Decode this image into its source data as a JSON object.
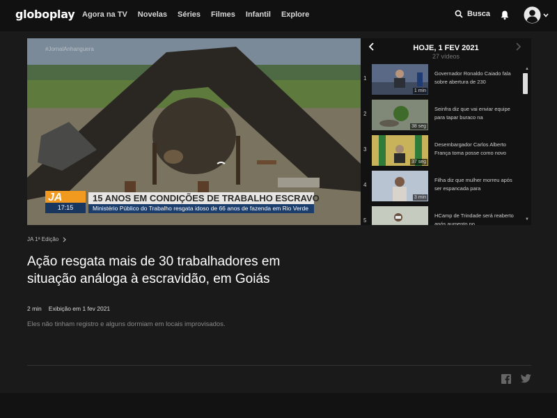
{
  "brand": {
    "logo": "globoplay"
  },
  "nav": {
    "items": [
      "Agora na TV",
      "Novelas",
      "Séries",
      "Filmes",
      "Infantil",
      "Explore"
    ]
  },
  "header": {
    "search_label": "Busca"
  },
  "player": {
    "overlay": {
      "watermark": "#JornalAnhanguera",
      "program_logo": "JA",
      "time": "17:15",
      "headline": "15 ANOS EM CONDIÇÕES DE TRABALHO ESCRAVO",
      "subline": "Ministério Público do Trabalho resgata idoso de 66 anos de fazenda em Rio Verde"
    }
  },
  "playlist": {
    "title": "HOJE, 1 FEV 2021",
    "count": "27 vídeos",
    "items": [
      {
        "num": "1",
        "text": "Governador Ronaldo Caiado fala sobre abertura de 230",
        "duration": "1 min",
        "thumb_color": "#5a6a86"
      },
      {
        "num": "2",
        "text": "Seinfra diz que vai enviar equipe para tapar buraco na",
        "duration": "38 seg",
        "thumb_color": "#6f7d68"
      },
      {
        "num": "3",
        "text": "Desembargador Carlos Alberto França toma posse como novo",
        "duration": "37 seg",
        "thumb_color": "#4f7a3e"
      },
      {
        "num": "4",
        "text": "Filha diz que mulher morreu após ser espancada para",
        "duration": "3 min",
        "thumb_color": "#a8b6c8"
      },
      {
        "num": "5",
        "text": "HCamp de Trindade será reaberto após aumento no",
        "duration": "",
        "thumb_color": "#bcc2b8"
      }
    ]
  },
  "video": {
    "program": "JA 1ª Edição",
    "title": "Ação resgata mais de 30 trabalhadores em situação análoga à escravidão, em Goiás",
    "duration": "2 min",
    "aired": "Exibição em 1 fev 2021",
    "description": "Eles não tinham registro e alguns dormiam em locais improvisados."
  },
  "colors": {
    "background": "#1a1a1a",
    "topbar": "#111111",
    "ja_orange": "#f29a1f",
    "ja_blue": "#1b3d6b"
  }
}
